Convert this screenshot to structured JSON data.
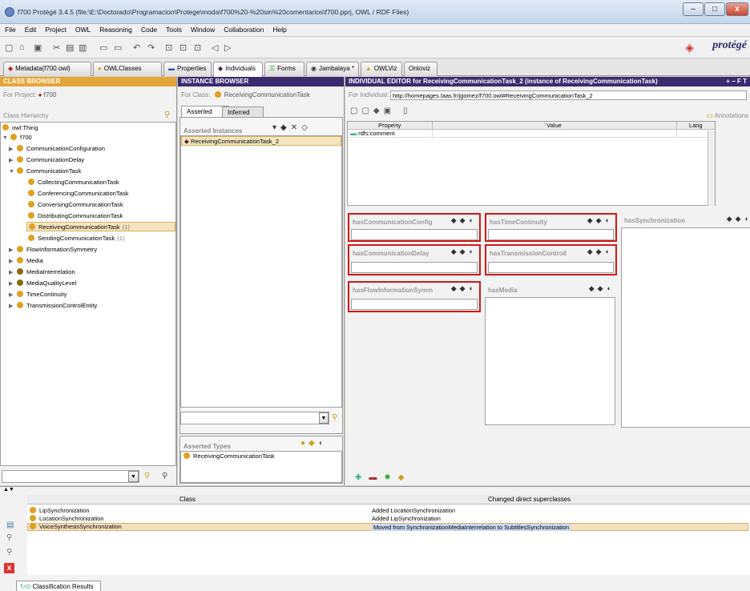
{
  "window": {
    "title": "f700  Protégé 3.4.5    (file:\\E:\\Doctorado\\Programacion\\Protege\\moda\\f700%20-%20sin%20comentarios\\f700.pprj, OWL / RDF Files)"
  },
  "menu": [
    "File",
    "Edit",
    "Project",
    "OWL",
    "Reasoning",
    "Code",
    "Tools",
    "Window",
    "Collaboration",
    "Help"
  ],
  "logo": "protégé",
  "tabs": [
    {
      "label": "Metadata(f700.owl)"
    },
    {
      "label": "OWLClasses"
    },
    {
      "label": "Properties"
    },
    {
      "label": "Individuals"
    },
    {
      "label": "Forms"
    },
    {
      "label": "Jambalaya *"
    },
    {
      "label": "OWLViz"
    },
    {
      "label": "Ontoviz"
    }
  ],
  "class_browser": {
    "header": "CLASS BROWSER",
    "for_project_label": "For Project:",
    "project": "f700",
    "hierarchy_label": "Class Hierarchy",
    "items": [
      {
        "label": "owl:Thing",
        "count": ""
      },
      {
        "label": "f700",
        "count": ""
      },
      {
        "label": "CommunicationConfiguration",
        "count": ""
      },
      {
        "label": "CommunicationDelay",
        "count": ""
      },
      {
        "label": "CommunicationTask",
        "count": ""
      },
      {
        "label": "CollectingCommunicationTask",
        "count": ""
      },
      {
        "label": "ConferencingCommunicationTask",
        "count": ""
      },
      {
        "label": "ConversingCommunicationTask",
        "count": ""
      },
      {
        "label": "DistributingCommunicationTask",
        "count": ""
      },
      {
        "label": "ReceivingCommunicationTask",
        "count": "(1)"
      },
      {
        "label": "SendingCommunicationTask",
        "count": "(1)"
      },
      {
        "label": "FlowInformationSymmetry",
        "count": ""
      },
      {
        "label": "Media",
        "count": ""
      },
      {
        "label": "MediaInterrelation",
        "count": ""
      },
      {
        "label": "MediaQualityLevel",
        "count": ""
      },
      {
        "label": "TimeContinuity",
        "count": ""
      },
      {
        "label": "TransmissionControlEntity",
        "count": ""
      }
    ]
  },
  "instance_browser": {
    "header": "INSTANCE BROWSER",
    "for_class_label": "For Class:",
    "class_name": "ReceivingCommunicationTask",
    "tab_asserted": "Asserted",
    "tab_inferred": "Inferred",
    "asserted_instances_label": "Asserted Instances",
    "instances": [
      "ReceivingCommunicationTask_2"
    ],
    "asserted_types_label": "Asserted Types",
    "types": [
      "ReceivingCommunicationTask"
    ]
  },
  "individual_editor": {
    "header": "INDIVIDUAL EDITOR for ReceivingCommunicationTask_2  (instance of ReceivingCommunicationTask)",
    "header_controls": "+ − F T",
    "for_individual_label": "For Individual:",
    "individual_uri": "http://homepages.laas.fr/jgomez/f700.owl#ReceivingCommunicationTask_2",
    "annotations_label": "Annotations",
    "table_headers": {
      "property": "Property",
      "value": "Value",
      "lang": "Lang"
    },
    "annotation_rows": [
      {
        "property": "rdfs:comment",
        "value": "",
        "lang": ""
      }
    ],
    "slots": {
      "s1": "hasCommunicationConfig",
      "s2": "hasTimeContinuity",
      "s3": "hasSynchronization",
      "s4": "hasCommunicationDelay",
      "s5": "hasTransmissionControll",
      "s6": "hasFlowInformationSymm",
      "s7": "hasMedia"
    }
  },
  "classification": {
    "col_class": "Class",
    "col_changed": "Changed direct superclasses",
    "rows": [
      {
        "cls": "LipSynchronization",
        "change": "Added LocationSynchronization"
      },
      {
        "cls": "LocationSynchronization",
        "change": "Added LipSynchronization"
      },
      {
        "cls": "VoiceSynthesisSynchronization",
        "change": "Moved from SynchronizationMediaInterrelation to SubtitlesSynchronization"
      }
    ],
    "results_tab": "Classification Results"
  },
  "colors": {
    "accent_orange": "#e4a63a",
    "header_purple": "#3b2a6e",
    "highlight_red": "#d01818"
  }
}
